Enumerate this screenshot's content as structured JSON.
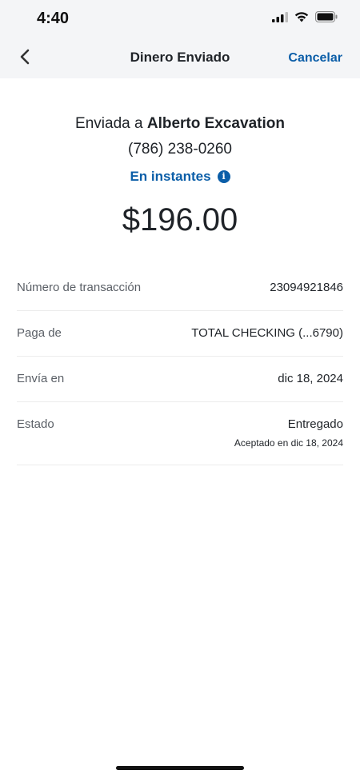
{
  "status_bar": {
    "time": "4:40",
    "icons": [
      "signal-icon",
      "wifi-icon",
      "battery-icon"
    ]
  },
  "nav": {
    "back_icon": "chevron-left-icon",
    "title": "Dinero Enviado",
    "cancel_label": "Cancelar"
  },
  "summary": {
    "sent_prefix": "Enviada a",
    "recipient_name": "Alberto Excavation",
    "phone": "(786) 238-0260",
    "speed_label": "En instantes",
    "info_icon": "info-icon",
    "amount": "$196.00"
  },
  "details": [
    {
      "label": "Número de transacción",
      "value": "23094921846"
    },
    {
      "label": "Paga de",
      "value": "TOTAL CHECKING (...6790)"
    },
    {
      "label": "Envía en",
      "value": "dic 18, 2024"
    },
    {
      "label": "Estado",
      "value": "Entregado",
      "sub": "Aceptado en dic 18, 2024"
    }
  ],
  "colors": {
    "accent": "#0b5ea8",
    "header_bg": "#f4f5f7",
    "text": "#1f2328",
    "muted": "#5a5f66"
  }
}
